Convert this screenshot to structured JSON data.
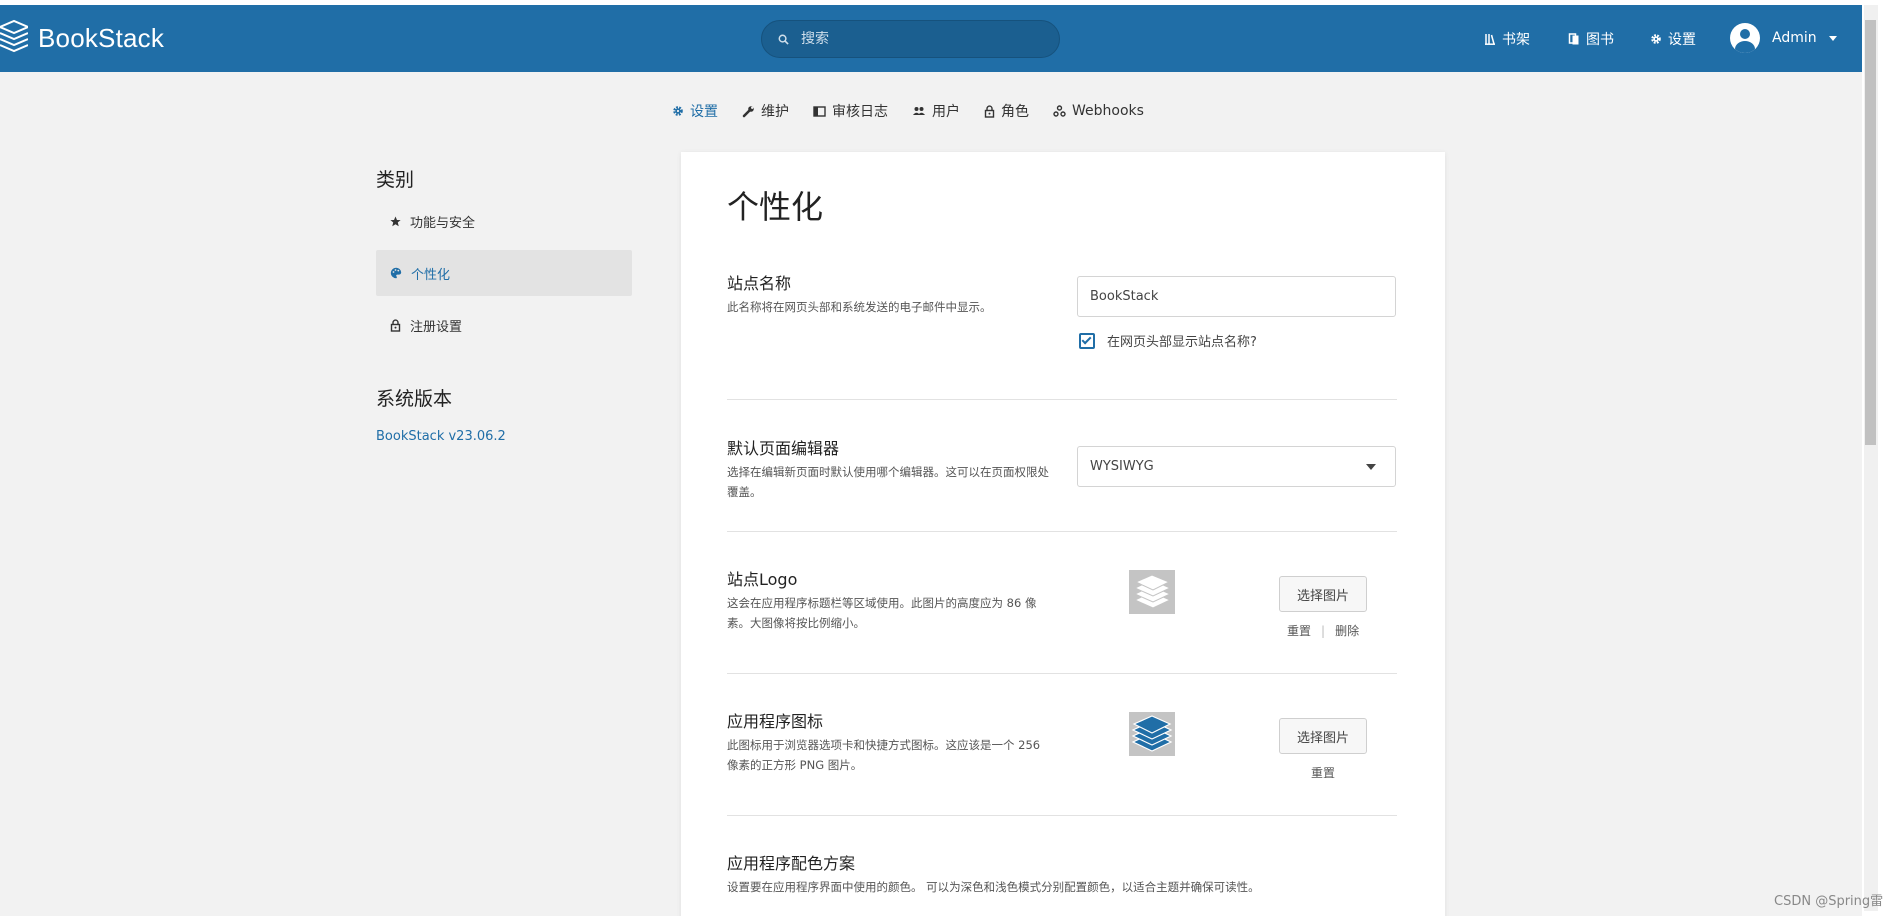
{
  "header": {
    "app_name": "BookStack",
    "search_placeholder": "搜索",
    "nav": [
      {
        "label": "书架",
        "icon": "shelves-icon"
      },
      {
        "label": "图书",
        "icon": "books-icon"
      },
      {
        "label": "设置",
        "icon": "gear-icon"
      }
    ],
    "user_name": "Admin"
  },
  "subnav": [
    {
      "label": "设置",
      "icon": "gear-icon",
      "active": true
    },
    {
      "label": "维护",
      "icon": "wrench-icon",
      "active": false
    },
    {
      "label": "审核日志",
      "icon": "audit-log-icon",
      "active": false
    },
    {
      "label": "用户",
      "icon": "users-icon",
      "active": false
    },
    {
      "label": "角色",
      "icon": "lock-icon",
      "active": false
    },
    {
      "label": "Webhooks",
      "icon": "webhooks-icon",
      "active": false
    }
  ],
  "sidebar": {
    "category_heading": "类别",
    "items": [
      {
        "label": "功能与安全",
        "icon": "star-icon"
      },
      {
        "label": "个性化",
        "icon": "palette-icon",
        "active": true
      },
      {
        "label": "注册设置",
        "icon": "lock-icon"
      }
    ],
    "version_heading": "系统版本",
    "version_link": "BookStack v23.06.2"
  },
  "main": {
    "title": "个性化",
    "site_name": {
      "label": "站点名称",
      "desc": "此名称将在网页头部和系统发送的电子邮件中显示。",
      "value": "BookStack",
      "checkbox_label": "在网页头部显示站点名称?",
      "checked": true
    },
    "default_editor": {
      "label": "默认页面编辑器",
      "desc": "选择在编辑新页面时默认使用哪个编辑器。这可以在页面权限处覆盖。",
      "value": "WYSIWYG"
    },
    "site_logo": {
      "label": "站点Logo",
      "desc": "这会在应用程序标题栏等区域使用。此图片的高度应为 86 像素。大图像将按比例缩小。",
      "button": "选择图片",
      "reset": "重置",
      "separator": "|",
      "remove": "删除"
    },
    "app_icon": {
      "label": "应用程序图标",
      "desc": "此图标用于浏览器选项卡和快捷方式图标。这应该是一个 256 像素的正方形 PNG 图片。",
      "button": "选择图片",
      "reset": "重置"
    },
    "color_scheme": {
      "label": "应用程序配色方案",
      "desc": "设置要在应用程序界面中使用的颜色。 可以为深色和浅色模式分别配置颜色，以适合主题并确保可读性。"
    }
  },
  "watermark": "CSDN @Spring雷",
  "colors": {
    "brand": "#206ea7"
  }
}
